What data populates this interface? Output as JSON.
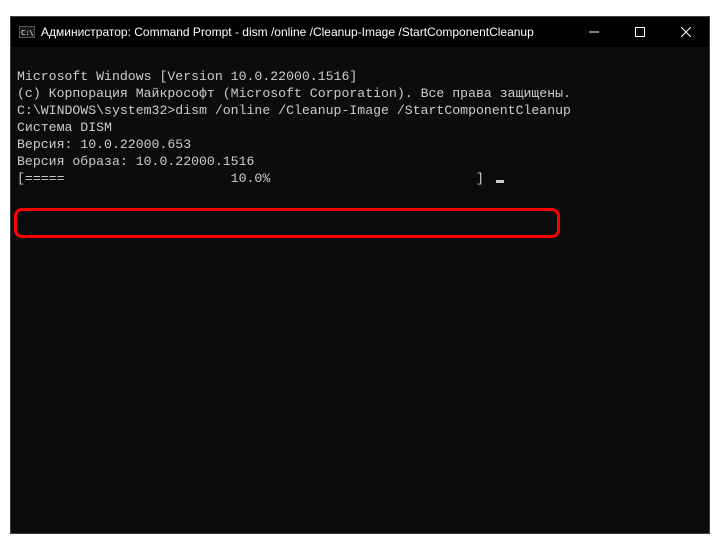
{
  "titlebar": {
    "title": "Администратор: Command Prompt - dism  /online /Cleanup-Image /StartComponentCleanup"
  },
  "terminal": {
    "line1": "Microsoft Windows [Version 10.0.22000.1516]",
    "line2": "(c) Корпорация Майкрософт (Microsoft Corporation). Все права защищены.",
    "blank1": "",
    "prompt": "C:\\WINDOWS\\system32>dism /online /Cleanup-Image /StartComponentCleanup",
    "blank2": "",
    "system_line": "Cистема DISM",
    "version_line": "Версия: 10.0.22000.653",
    "blank3": "",
    "image_version": "Версия образа: 10.0.22000.1516",
    "blank4": "",
    "progress": "[=====                     10.0%                          ] "
  }
}
